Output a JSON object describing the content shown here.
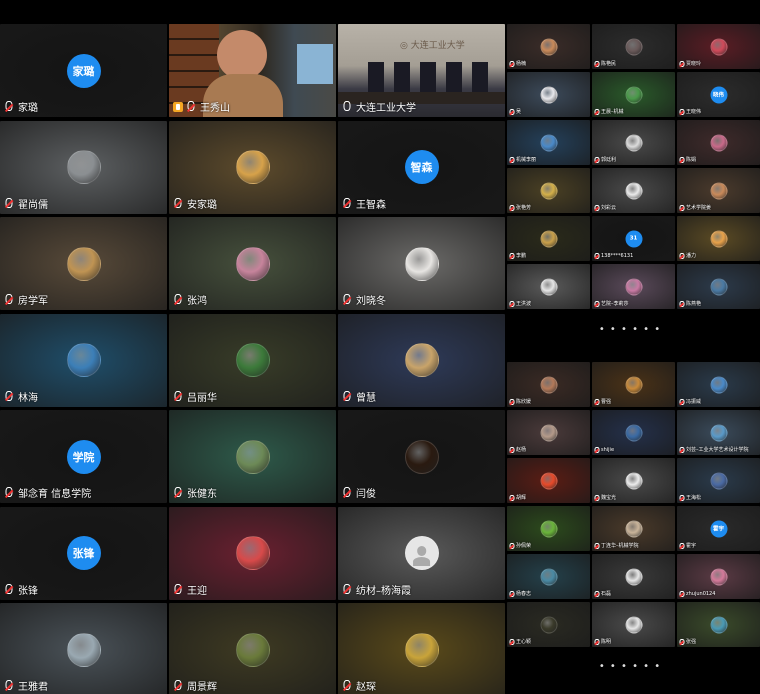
{
  "meeting": {
    "big_grid": [
      {
        "name": "家璐",
        "avatar_text": "家璐",
        "avatar_type": "text",
        "avatar_color": "#1e8cf0",
        "bg": "#141414"
      },
      {
        "name": "王秀山",
        "avatar_type": "video-person",
        "bg": "#3a3024",
        "active": true,
        "hand": true
      },
      {
        "name": "大连工业大学",
        "avatar_type": "video-room",
        "bg": "#8f8a82",
        "mic_on": true
      },
      {
        "name": "翟尚儒",
        "avatar_type": "photo",
        "photo": "#8b8f92",
        "bg": "#5d6062"
      },
      {
        "name": "安家璐",
        "avatar_type": "photo",
        "photo": "#d7a24a",
        "bg": "#5d4b2c"
      },
      {
        "name": "王智森",
        "avatar_text": "智森",
        "avatar_type": "text",
        "avatar_color": "#1e8cf0",
        "bg": "#141414"
      },
      {
        "name": "房学军",
        "avatar_type": "photo",
        "photo": "#c09453",
        "bg": "#584a39"
      },
      {
        "name": "张鸿",
        "avatar_type": "photo",
        "photo": "#c7849c",
        "bg": "#46503c"
      },
      {
        "name": "刘晓冬",
        "avatar_type": "photo",
        "photo": "#e7e5e2",
        "bg": "#6b6a68"
      },
      {
        "name": "林海",
        "avatar_type": "photo",
        "photo": "#3c7fb8",
        "bg": "#1f4e6a"
      },
      {
        "name": "吕丽华",
        "avatar_type": "photo",
        "photo": "#3c7a3a",
        "bg": "#383c28"
      },
      {
        "name": "曾慧",
        "avatar_type": "photo",
        "photo": "#c9a46a",
        "bg": "#2e3a58"
      },
      {
        "name": "邹念育 信息学院",
        "avatar_text": "学院",
        "avatar_type": "text",
        "avatar_color": "#1e8cf0",
        "bg": "#141414"
      },
      {
        "name": "张健东",
        "avatar_type": "photo",
        "photo": "#6d8a57",
        "bg": "#2e5a4a"
      },
      {
        "name": "闫俊",
        "avatar_type": "photo",
        "photo": "#2a1a10",
        "bg": "#141414"
      },
      {
        "name": "张锋",
        "avatar_text": "张锋",
        "avatar_type": "text",
        "avatar_color": "#1e8cf0",
        "bg": "#141414"
      },
      {
        "name": "王迎",
        "avatar_type": "photo",
        "photo": "#d84a4a",
        "bg": "#6a2030"
      },
      {
        "name": "纺材–杨海霞",
        "avatar_type": "default",
        "photo": "#e6e6e6",
        "bg": "#5a5a5a"
      },
      {
        "name": "王雅君",
        "avatar_type": "photo",
        "photo": "#9aa9b2",
        "bg": "#4a5258"
      },
      {
        "name": "周景辉",
        "avatar_type": "photo",
        "photo": "#6a7a3a",
        "bg": "#3e3a22"
      },
      {
        "name": "赵琛",
        "avatar_type": "photo",
        "photo": "#c9a43a",
        "bg": "#5a4a1a"
      }
    ],
    "small_grid_a": [
      {
        "name": "杨楠",
        "photo": "#c98a5a",
        "bg": "#3a2c28"
      },
      {
        "name": "陈艳民",
        "photo": "#6a5a5a",
        "bg": "#2c2c2c"
      },
      {
        "name": "贾晓玲",
        "photo": "#d04a5a",
        "bg": "#5a1c24"
      },
      {
        "name": "吴",
        "photo": "#e8e8ec",
        "bg": "#3c4a5a"
      },
      {
        "name": "王晨–机械",
        "photo": "#4a9a4a",
        "bg": "#2a5a2a"
      },
      {
        "name": "王晓伟",
        "avatar_text": "晓伟",
        "avatar_color": "#1e8cf0",
        "bg": "#2c2c2c"
      },
      {
        "name": "机械李丽",
        "photo": "#4a8ac9",
        "bg": "#24405a"
      },
      {
        "name": "郭廷利",
        "photo": "#dcdcdc",
        "bg": "#4a4a4a"
      },
      {
        "name": "陈娟",
        "photo": "#c96a8a",
        "bg": "#3e2a2a"
      },
      {
        "name": "张艳芳",
        "photo": "#d4b04a",
        "bg": "#4a4024"
      },
      {
        "name": "刘彩云",
        "photo": "#eaeaea",
        "bg": "#4a4a4a"
      },
      {
        "name": "艺术学院姜",
        "photo": "#c98a5a",
        "bg": "#4a3a2c"
      },
      {
        "name": "李鹏",
        "photo": "#c9a04a",
        "bg": "#2a2a1a"
      },
      {
        "name": "138****6131",
        "avatar_text": "31",
        "avatar_color": "#1e8cf0",
        "bg": "#141414"
      },
      {
        "name": "潘力",
        "photo": "#e8a24a",
        "bg": "#5a4a24"
      },
      {
        "name": "王洪波",
        "photo": "#e6e6e6",
        "bg": "#5a5a5a"
      },
      {
        "name": "艺院–李莉莎",
        "photo": "#c97aa4",
        "bg": "#5a4a5a"
      },
      {
        "name": "陈燕艳",
        "photo": "#4a7aa4",
        "bg": "#2c3a4a"
      }
    ],
    "small_grid_b": [
      {
        "name": "陈欣媛",
        "photo": "#b47a5a",
        "bg": "#3a2a24"
      },
      {
        "name": "曹强",
        "photo": "#c98a3a",
        "bg": "#4a3218"
      },
      {
        "name": "冯振威",
        "photo": "#4a8ac9",
        "bg": "#2a3a4a"
      },
      {
        "name": "赵杨",
        "photo": "#b49a8a",
        "bg": "#4a3a3a"
      },
      {
        "name": "shijie",
        "photo": "#3a6aa4",
        "bg": "#24304a"
      },
      {
        "name": "刘芸–工业大学艺术设计学院",
        "photo": "#5a9ac9",
        "bg": "#3a4a5a"
      },
      {
        "name": "胡辉",
        "photo": "#e84a2a",
        "bg": "#5a1c14"
      },
      {
        "name": "魏宝光",
        "photo": "#ececec",
        "bg": "#4a4a4a"
      },
      {
        "name": "王海松",
        "photo": "#4a6aa4",
        "bg": "#2a3a4a"
      },
      {
        "name": "孙佩荣",
        "photo": "#6ab43a",
        "bg": "#2c4a1c"
      },
      {
        "name": "丁连华–机械学院",
        "photo": "#c9b49a",
        "bg": "#4a3a2a"
      },
      {
        "name": "霍宇",
        "avatar_text": "霍宇",
        "avatar_color": "#1e8cf0",
        "bg": "#2a2a2a"
      },
      {
        "name": "杨春志",
        "photo": "#4a8aa4",
        "bg": "#24404a"
      },
      {
        "name": "石磊",
        "photo": "#e6e6e6",
        "bg": "#3a3a3a"
      },
      {
        "name": "zhujun0124",
        "photo": "#d47a9a",
        "bg": "#5a3a44"
      },
      {
        "name": "王心颖",
        "photo": "#3a3a2a",
        "bg": "#2a2a22"
      },
      {
        "name": "陈明",
        "photo": "#e6e6e6",
        "bg": "#4a4a4a"
      },
      {
        "name": "张强",
        "photo": "#4a9ab4",
        "bg": "#3a4a2a"
      }
    ]
  }
}
